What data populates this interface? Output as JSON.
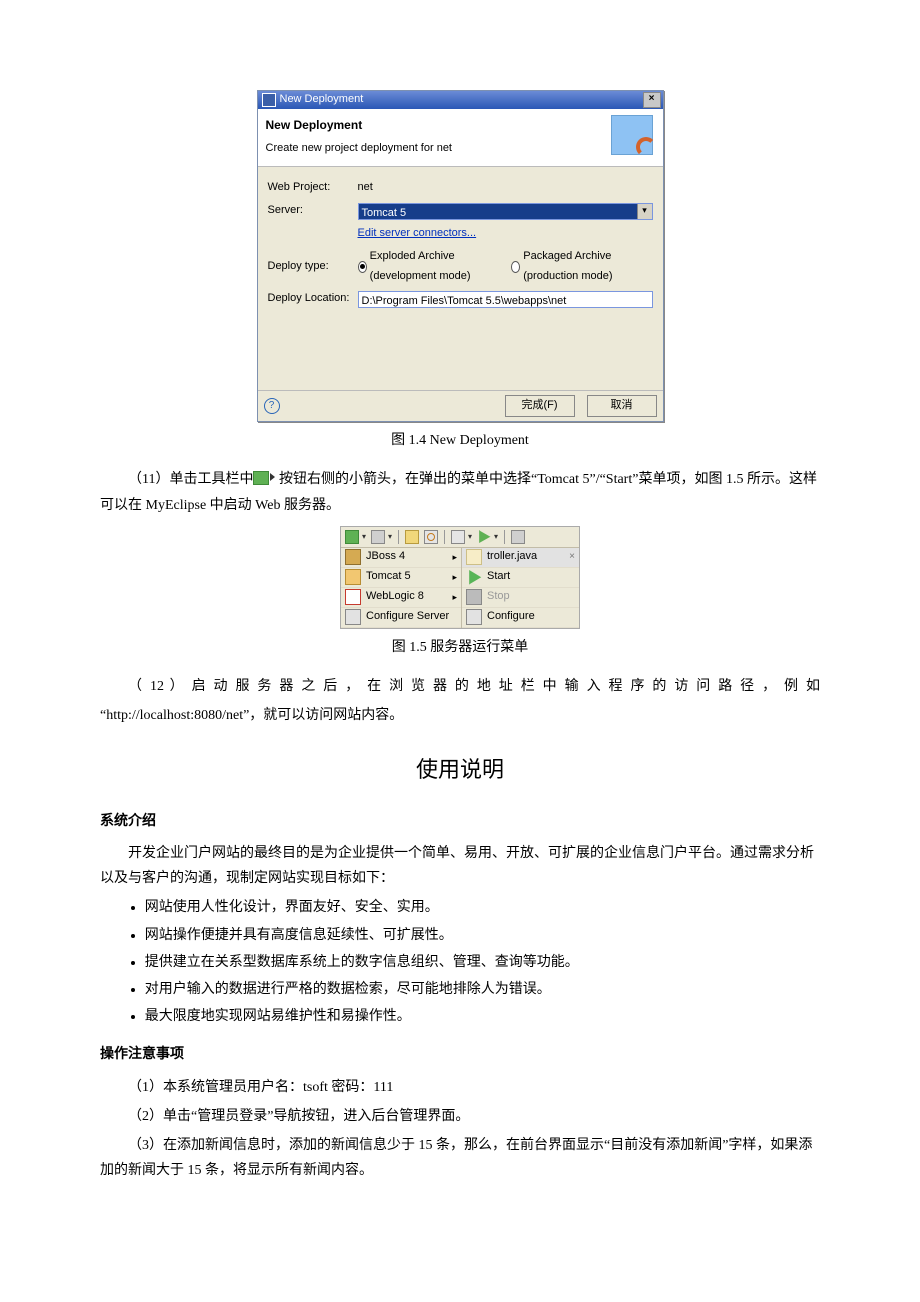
{
  "dialog": {
    "titlebar": "New Deployment",
    "header_title": "New Deployment",
    "header_sub": "Create new project deployment for net",
    "web_project_label": "Web Project:",
    "web_project_value": "net",
    "server_label": "Server:",
    "server_value": "Tomcat 5",
    "edit_connectors_link": "Edit server connectors...",
    "deploy_type_label": "Deploy type:",
    "radio_exploded": "Exploded Archive (development mode)",
    "radio_packaged": "Packaged Archive (production mode)",
    "deploy_loc_label": "Deploy Location:",
    "deploy_loc_value": "D:\\Program Files\\Tomcat 5.5\\webapps\\net",
    "btn_finish": "完成(F)",
    "btn_cancel": "取消"
  },
  "caption_fig4": "图 1.4    New Deployment",
  "para11": "（11）单击工具栏中      按钮右侧的小箭头，在弹出的菜单中选择“Tomcat 5”/“Start”菜单项，如图 1.5 所示。这样可以在 MyEclipse 中启动 Web 服务器。",
  "menu": {
    "editor_tab": "troller.java",
    "left_items": [
      "JBoss 4",
      "Tomcat 5",
      "WebLogic 8",
      "Configure Server"
    ],
    "right_items": [
      "Start",
      "Stop",
      "Configure"
    ]
  },
  "caption_fig5": "图 1.5    服务器运行菜单",
  "para12_a": "（ 12 ） 启 动 服 务 器 之 后 ， 在 浏 览 器 的 地 址 栏 中 输 入 程 序 的 访 问 路 径 ， 例 如",
  "para12_b": "“http://localhost:8080/net”，就可以访问网站内容。",
  "section_usage": "使用说明",
  "sub_intro": "系统介绍",
  "intro_para": "开发企业门户网站的最终目的是为企业提供一个简单、易用、开放、可扩展的企业信息门户平台。通过需求分析以及与客户的沟通，现制定网站实现目标如下：",
  "bullets": [
    "网站使用人性化设计，界面友好、安全、实用。",
    "网站操作便捷并具有高度信息延续性、可扩展性。",
    "提供建立在关系型数据库系统上的数字信息组织、管理、查询等功能。",
    "对用户输入的数据进行严格的数据检索，尽可能地排除人为错误。",
    "最大限度地实现网站易维护性和易操作性。"
  ],
  "sub_notes": "操作注意事项",
  "notes": [
    "（1）本系统管理员用户名：tsoft    密码：111",
    "（2）单击“管理员登录”导航按钮，进入后台管理界面。",
    "（3）在添加新闻信息时，添加的新闻信息少于 15 条，那么，在前台界面显示“目前没有添加新闻”字样，如果添加的新闻大于 15 条，将显示所有新闻内容。"
  ]
}
